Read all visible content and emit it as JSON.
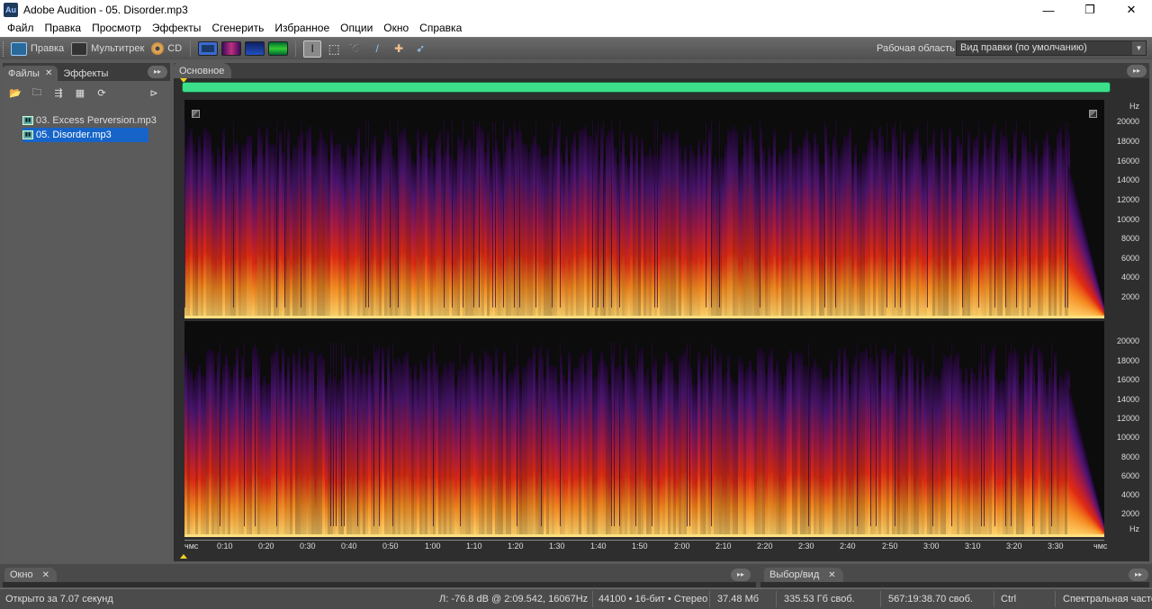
{
  "window": {
    "title": "Adobe Audition - 05. Disorder.mp3",
    "icon_label": "Au",
    "controls": {
      "minimize": "—",
      "maximize": "❐",
      "close": "✕"
    }
  },
  "menu": [
    "Файл",
    "Правка",
    "Просмотр",
    "Эффекты",
    "Сгенерить",
    "Избранное",
    "Опции",
    "Окно",
    "Справка"
  ],
  "toolbar": {
    "edit_label": "Правка",
    "multitrack_label": "Мультитрек",
    "cd_label": "CD",
    "workspace_label": "Рабочая область:",
    "workspace_value": "Вид правки (по умолчанию)"
  },
  "left_panel": {
    "tab_files": "Файлы",
    "tab_effects": "Эффекты",
    "files": [
      "03. Excess Perversion.mp3",
      "05. Disorder.mp3"
    ],
    "selected_index": 1
  },
  "main_panel": {
    "tab_label": "Основное",
    "hz_unit": "Hz",
    "hz_ticks": [
      "20000",
      "18000",
      "16000",
      "14000",
      "12000",
      "10000",
      "8000",
      "6000",
      "4000",
      "2000"
    ],
    "time_unit": "чмс",
    "time_ticks": [
      "0:10",
      "0:20",
      "0:30",
      "0:40",
      "0:50",
      "1:00",
      "1:10",
      "1:20",
      "1:30",
      "1:40",
      "1:50",
      "2:00",
      "2:10",
      "2:20",
      "2:30",
      "2:40",
      "2:50",
      "3:00",
      "3:10",
      "3:20",
      "3:30"
    ]
  },
  "bottom_panels": {
    "window_tab": "Окно",
    "selection_tab": "Выбор/вид"
  },
  "status": {
    "opened": "Открыто за 7.07 секунд",
    "cursor": "Л: -76.8 dB @  2:09.542, 16067Hz",
    "format": "44100 • 16-бит • Стерео",
    "size": "37.48 Мб",
    "free_space": "335.53 Гб своб.",
    "free_time": "567:19:38.70 своб.",
    "modifier": "Ctrl",
    "view_mode": "Спектральная частота"
  },
  "colors": {
    "overview_bar": "#3ce08a",
    "selected_file": "#1664c8",
    "spectrum_hot": "#ffd060",
    "spectrum_mid": "#e02010",
    "spectrum_cold": "#5a1a78"
  }
}
